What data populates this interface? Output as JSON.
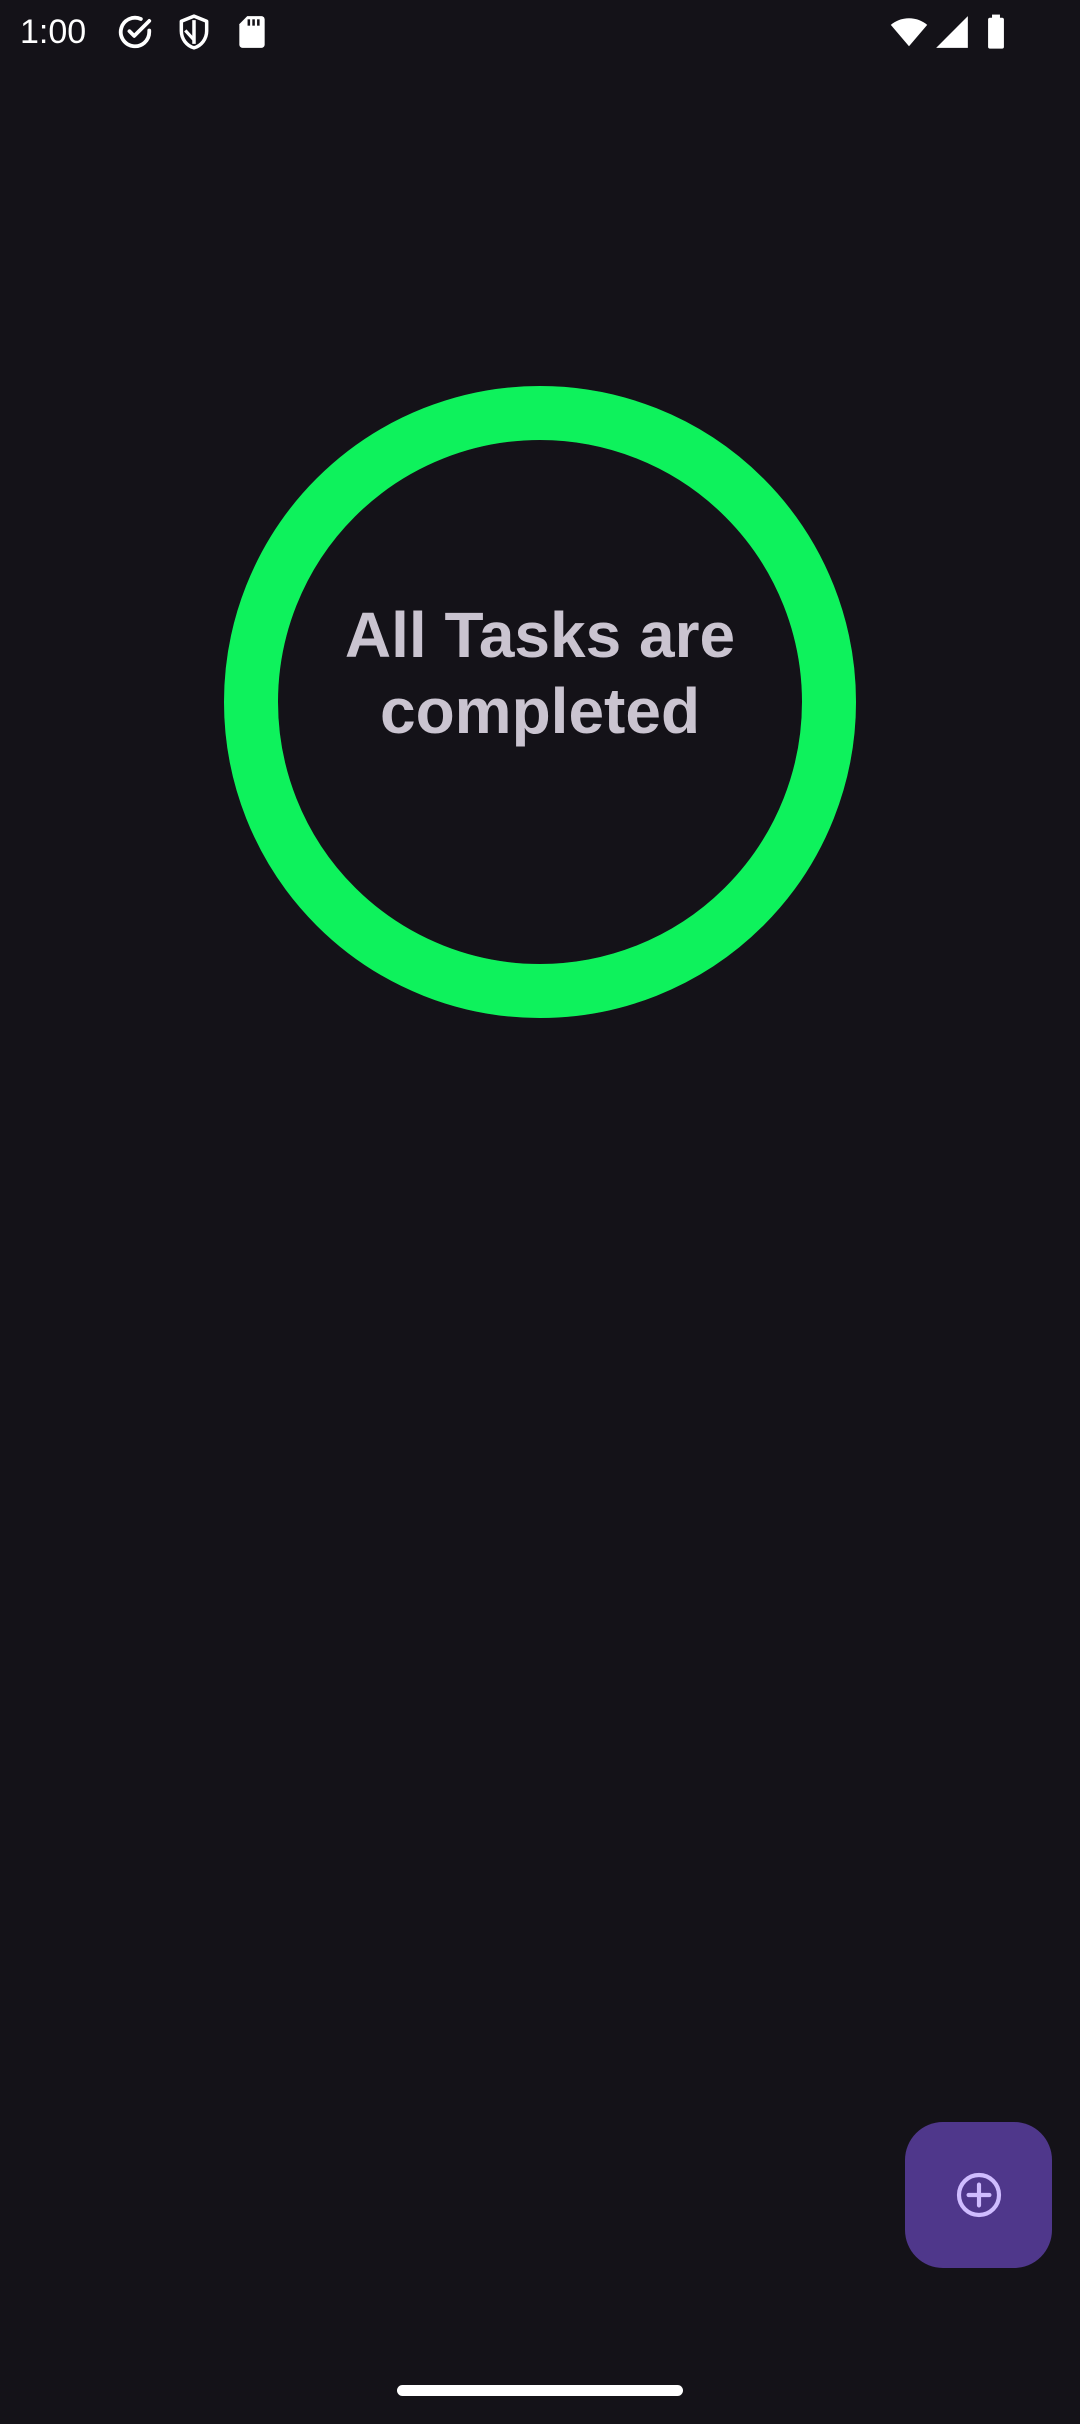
{
  "status_bar": {
    "time": "1:00",
    "left_icons": [
      "check-circle-icon",
      "shield-icon",
      "sd-card-icon"
    ],
    "right_icons": [
      "wifi-icon",
      "signal-icon",
      "battery-icon"
    ]
  },
  "progress": {
    "label": "All Tasks are completed",
    "completed_fraction": 1.0,
    "ring_color": "#0ef25c",
    "text_color": "#cac4d0"
  },
  "fab": {
    "icon": "add-circle-icon",
    "background": "#4f378b",
    "icon_color": "#cfbcff"
  },
  "theme": {
    "background": "#141218"
  }
}
